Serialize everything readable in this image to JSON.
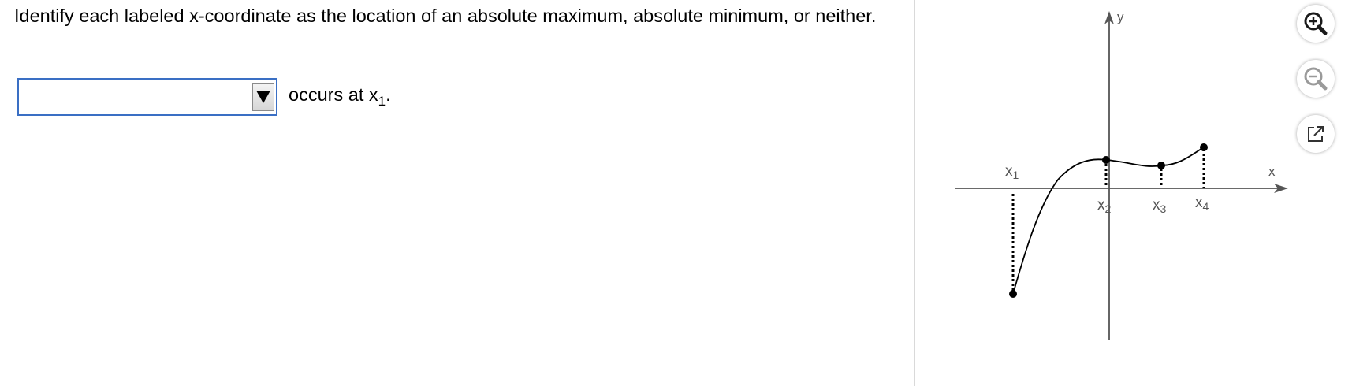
{
  "question": {
    "prompt": "Identify each labeled x-coordinate as the location of an absolute maximum, absolute minimum, or neither."
  },
  "answer": {
    "dropdown_value": "",
    "text_before_sub": "occurs at x",
    "subscript": "1",
    "text_after": "."
  },
  "graph": {
    "axis_x_label": "x",
    "axis_y_label": "y",
    "point_labels": [
      "x",
      "x",
      "x",
      "x"
    ],
    "point_subscripts": [
      "1",
      "2",
      "3",
      "4"
    ]
  },
  "toolbar": {
    "zoom_in_icon": "zoom-in-icon",
    "zoom_out_icon": "zoom-out-icon",
    "popout_icon": "external-link-icon"
  },
  "colors": {
    "dropdown_border": "#3a6fc4",
    "zoom_in": "#1a1a1a",
    "zoom_out": "#9a9a9a"
  }
}
